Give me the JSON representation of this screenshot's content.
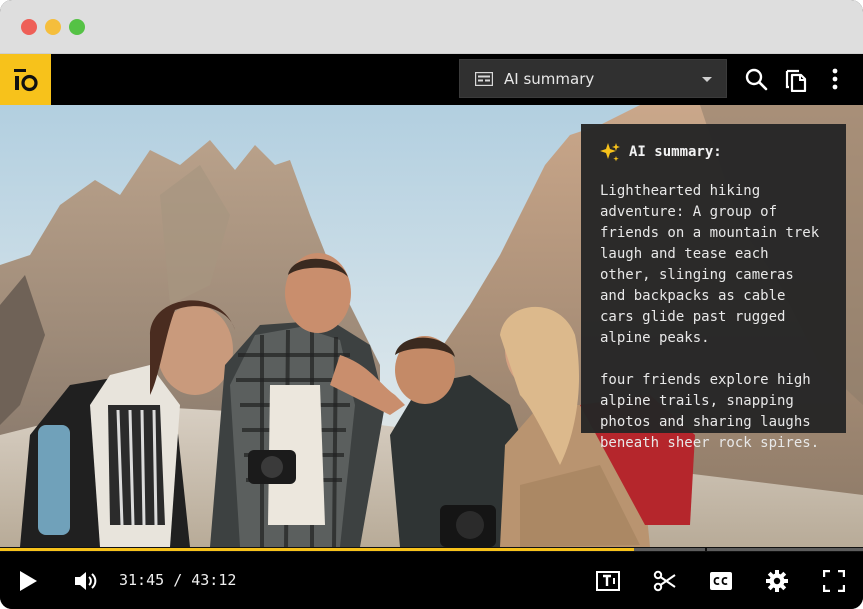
{
  "topbar": {
    "mode_select": {
      "label": "AI summary",
      "icon": "summary-icon"
    }
  },
  "summary": {
    "title": "AI summary:",
    "paragraph1": "Lighthearted hiking adventure: A group of friends on a mountain trek laugh and tease each other, slinging cameras and backpacks as cable cars glide past rugged alpine peaks.",
    "paragraph2": "four friends explore high alpine trails, snapping photos and sharing laughs beneath sheer rock spires."
  },
  "player": {
    "current_time": "31:45",
    "separator": "/",
    "duration": "43:12",
    "progress_fraction": 0.735
  },
  "colors": {
    "accent": "#f7c21b",
    "panel_bg": "#262626",
    "bar_bg": "#000000"
  }
}
